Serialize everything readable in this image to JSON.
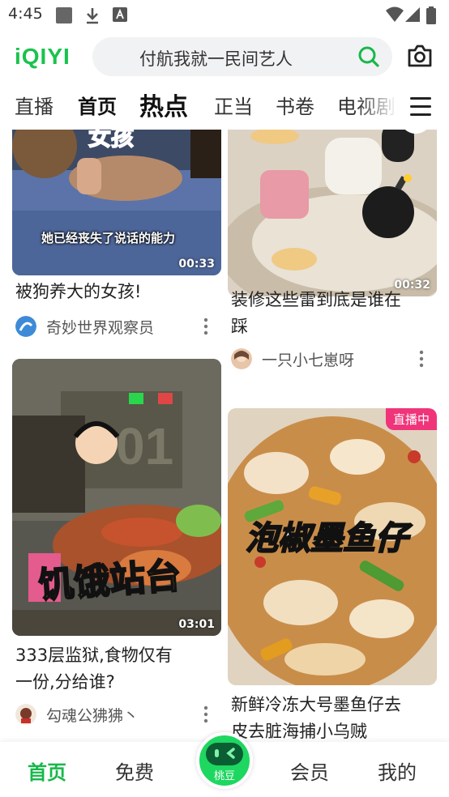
{
  "status_bar": {
    "time": "4:45"
  },
  "header": {
    "logo": "iQIYI",
    "search_text": "付航我就一民间艺人"
  },
  "tabs": [
    "直播",
    "首页",
    "热点",
    "正当",
    "书卷",
    "电视剧"
  ],
  "active_tab": "热点",
  "feed": {
    "cards": [
      {
        "title": "被狗养大的女孩!",
        "duration": "00:33",
        "author": "奇妙世界观察员",
        "overlay_1": "女孩",
        "overlay_2": "她已经丧失了说话的能力"
      },
      {
        "title_line1": "装修这些雷到底是谁在",
        "title_line2": "踩",
        "duration": "00:32",
        "author": "一只小七崽呀"
      },
      {
        "title_line1": "333层监狱,食物仅有",
        "title_line2": "一份,分给谁?",
        "duration": "03:01",
        "author": "勾魂公狒狒丶",
        "overlay": "饥饿站台",
        "sign": "01"
      },
      {
        "title_line1": "新鲜冷冻大号墨鱼仔去",
        "title_line2": "皮去脏海捕小乌贼",
        "badge": "直播中",
        "overlay": "泡椒墨鱼仔"
      }
    ]
  },
  "bottom_nav": {
    "home": "首页",
    "free": "免费",
    "center": "桃豆",
    "vip": "会员",
    "mine": "我的"
  },
  "colors": {
    "brand_green": "#19c34d",
    "live_pink": "#f0347a"
  }
}
